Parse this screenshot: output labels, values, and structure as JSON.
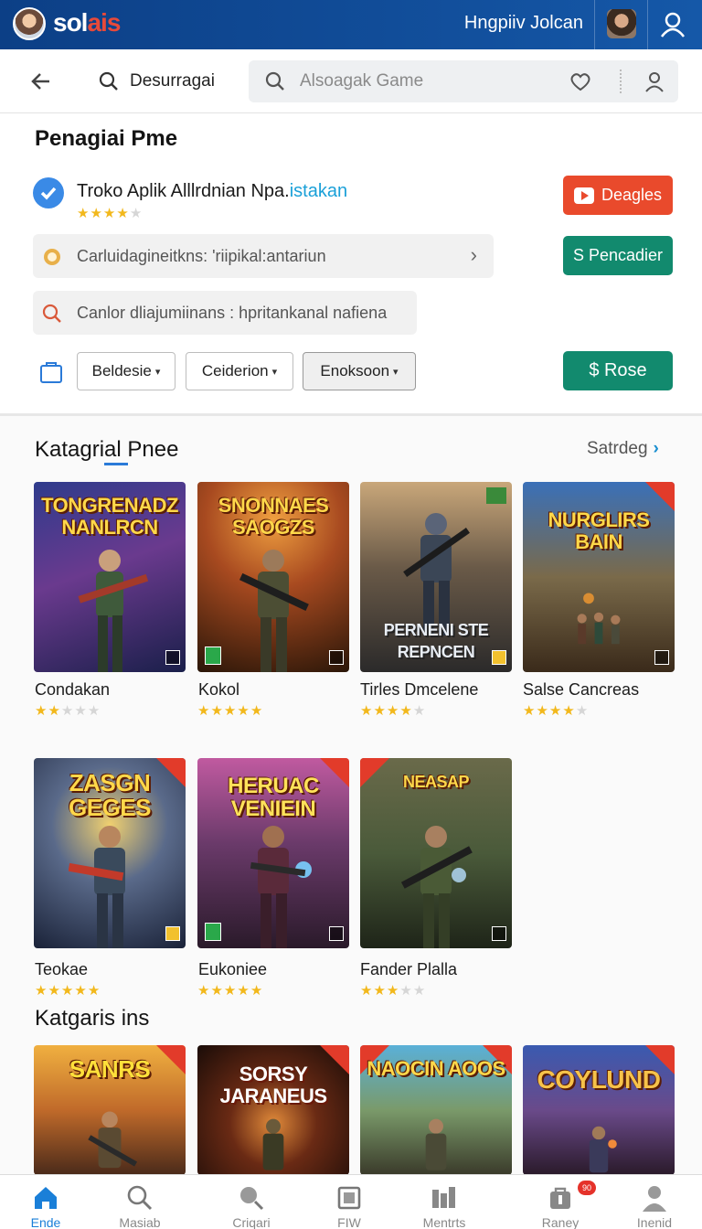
{
  "topbar": {
    "logo_text": "sol",
    "logo_text_tail": "ais",
    "user_name": "Hngpiiv Jolcan"
  },
  "search": {
    "location_label": "Desurragai",
    "placeholder": "Alsoagak Game"
  },
  "section_top": {
    "title": "Penagiai Pme",
    "app_name_main": "Troko Aplik Alllrdnian Npa.",
    "app_name_accent": "istakan",
    "app_rating": 4,
    "pill_1": "Carluidagineitkns: 'riipikal:antariun",
    "pill_2": "Canlor dliajumiinans : hpritankanal nafiena",
    "btn_1": "Deagles",
    "btn_2": "S Pencadier",
    "btn_3": "$ Rose",
    "filters": [
      "Beldesie",
      "Ceiderion",
      "Enoksoon"
    ]
  },
  "section_games": {
    "title_a": "Katagrial",
    "title_b": " Pnee",
    "see_all": "Satrdeg",
    "row1": [
      {
        "title_art": "TONGRENADZ NANLRCN",
        "name": "Condakan",
        "rating": 2
      },
      {
        "title_art": "SNONNAES SAOGZS",
        "name": "Kokol",
        "rating": 5
      },
      {
        "title_art": "PERNENI STE REPNCEN",
        "name": "Tirles Dmcelene",
        "rating": 4
      },
      {
        "title_art": "NURGLIRS BAIN",
        "name": "Salse Cancreas",
        "rating": 4
      }
    ],
    "row2": [
      {
        "title_art": "ZASGN GEGES",
        "name": "Teokae",
        "rating": 5
      },
      {
        "title_art": "HERUAC VENIEIN",
        "name": "Eukoniee",
        "rating": 5
      },
      {
        "title_art": "NEASAP",
        "name": "Fander Plalla",
        "rating": 3
      }
    ]
  },
  "section_bottom": {
    "title": "Katgaris ins",
    "row": [
      {
        "title_art": "SANRS"
      },
      {
        "title_art": "SORSY JARANEUS"
      },
      {
        "title_art": "NAOCIN AOOS"
      },
      {
        "title_art": "COYLUND"
      }
    ]
  },
  "bottom_nav": {
    "items": [
      {
        "label": "Ende",
        "icon": "home-icon"
      },
      {
        "label": "Masiab",
        "icon": "search-icon"
      },
      {
        "label": "Criqari",
        "icon": "search-icon"
      },
      {
        "label": "FIW",
        "icon": "square-icon"
      },
      {
        "label": "Mentrts",
        "icon": "chart-icon"
      },
      {
        "label": "Raney",
        "icon": "bag-icon",
        "badge": "90"
      },
      {
        "label": "Inenid",
        "icon": "person-icon"
      }
    ]
  },
  "colors": {
    "brand_blue": "#0c3f86",
    "accent_red": "#e94a2c",
    "accent_green": "#128a6e",
    "star_yellow": "#f2b81c",
    "link_blue": "#1a8fd0"
  }
}
